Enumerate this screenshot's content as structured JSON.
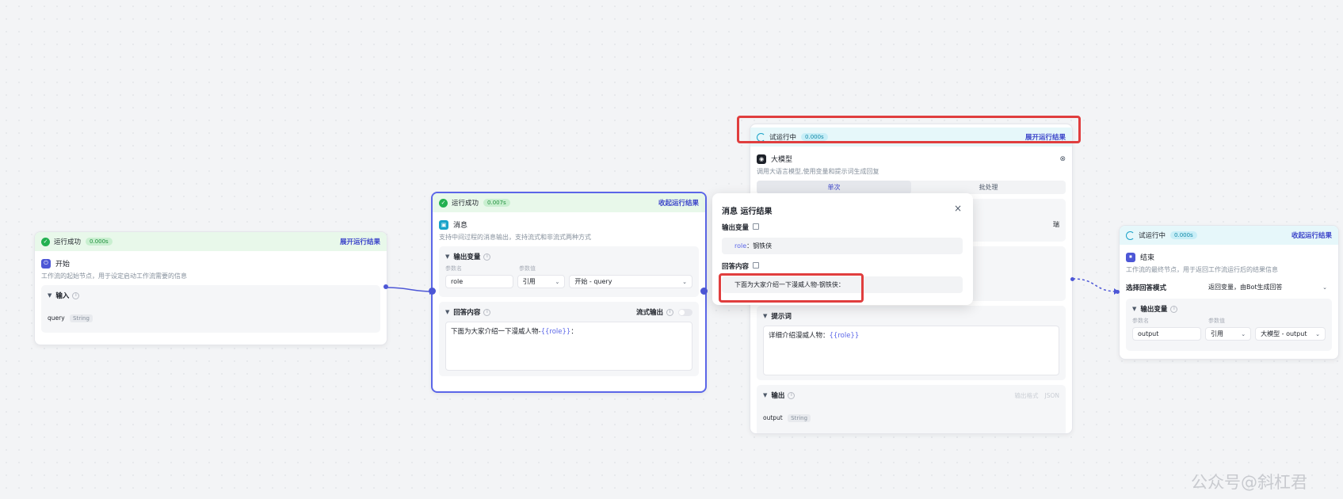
{
  "start_node": {
    "status": "运行成功",
    "time": "0.000s",
    "link": "展开运行结果",
    "title": "开始",
    "desc": "工作流的起始节点，用于设定启动工作流需要的信息",
    "section_title": "输入",
    "var_name": "query",
    "var_type": "String"
  },
  "message_node": {
    "status": "运行成功",
    "time": "0.007s",
    "link": "收起运行结果",
    "title": "消息",
    "desc": "支持中间过程的消息输出，支持流式和非流式两种方式",
    "output_title": "输出变量",
    "col_name": "参数名",
    "col_value": "参数值",
    "param_name": "role",
    "param_mode": "引用",
    "param_ref": "开始 - query",
    "answer_title": "回答内容",
    "stream_label": "流式输出",
    "answer_prefix": "下面为大家介绍一下漫威人物-",
    "answer_var": "{{role}}",
    "answer_suffix": "："
  },
  "llm_node": {
    "status": "试运行中",
    "time": "0.000s",
    "link": "展开运行结果",
    "title": "大模型",
    "desc": "调用大语言模型,使用变量和提示词生成回复",
    "tab_single": "单次",
    "tab_batch": "批处理",
    "prompt_title": "提示词",
    "prompt_prefix": "详细介绍漫威人物：",
    "prompt_var": "{{role}}",
    "output_title": "输出",
    "output_format_label": "输出格式",
    "output_format": "JSON",
    "output_var": "output",
    "output_type": "String",
    "side_text": "瑞"
  },
  "end_node": {
    "status": "试运行中",
    "time": "0.000s",
    "link": "收起运行结果",
    "title": "结束",
    "desc": "工作流的最终节点，用于返回工作流运行后的结果信息",
    "mode_label": "选择回答模式",
    "mode_value": "返回变量，由Bot生成回答",
    "output_title": "输出变量",
    "col_name": "参数名",
    "col_value": "参数值",
    "param_name": "output",
    "param_mode": "引用",
    "param_ref": "大模型 - output"
  },
  "popup": {
    "title": "消息 运行结果",
    "output_label": "输出变量",
    "output_key": "role",
    "output_value": "：钢铁侠",
    "answer_label": "回答内容",
    "answer_value": "下面为大家介绍一下漫威人物-钢铁侠："
  },
  "watermark": "公众号@斜杠君",
  "colors": {
    "accent": "#5b66e8",
    "success": "#22b050",
    "running": "#1aa3c9",
    "highlight": "#e03e3e"
  }
}
